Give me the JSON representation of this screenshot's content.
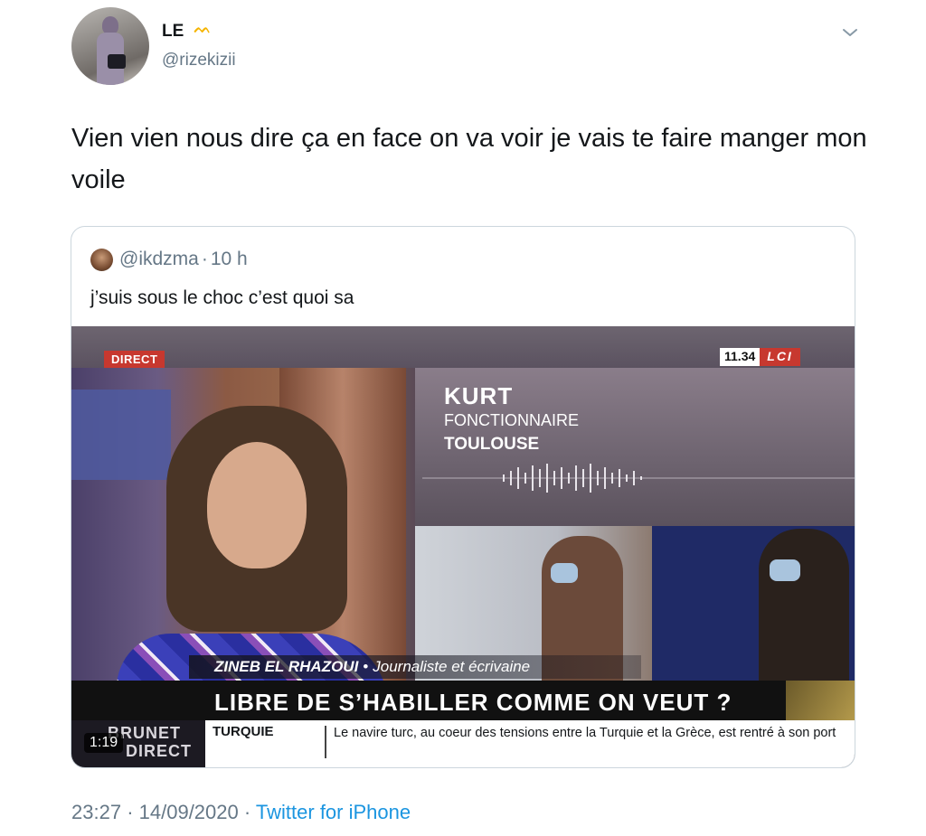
{
  "tweet": {
    "display_name": "LE",
    "name_emoji": "ᨓ",
    "handle": "@rizekizii",
    "text": "Vien vien nous dire ça en face on va voir je vais te faire manger mon voile",
    "time": "23:27",
    "date": "14/09/2020",
    "separator": "·",
    "source": "Twitter for iPhone"
  },
  "quote": {
    "handle": "@ikdzma",
    "separator": "·",
    "age": "10 h",
    "text": "j’suis sous le choc c’est quoi sa"
  },
  "video": {
    "duration": "1:19",
    "live_badge": "DIRECT",
    "clock": "11.34",
    "channel": "LCI",
    "caller_name": "KURT",
    "caller_job": "FONCTIONNAIRE",
    "caller_city": "TOULOUSE",
    "guest_name": "ZINEB EL RHAZOUI",
    "guest_sep": "•",
    "guest_title": "Journaliste et écrivaine",
    "headline": "LIBRE DE S’HABILLER COMME ON VEUT ?",
    "show_line1": "BRUNET",
    "show_line2": "DIRECT",
    "ticker_label": "TURQUIE",
    "ticker_text": "Le navire turc, au coeur des tensions entre la Turquie et la Grèce, est rentré à son port"
  },
  "colors": {
    "text_primary": "#14171a",
    "text_secondary": "#657786",
    "link": "#1b95e0",
    "border": "#ccd6dd",
    "lci_red": "#c7382f"
  },
  "icons": {
    "menu": "chevron-down-icon"
  }
}
